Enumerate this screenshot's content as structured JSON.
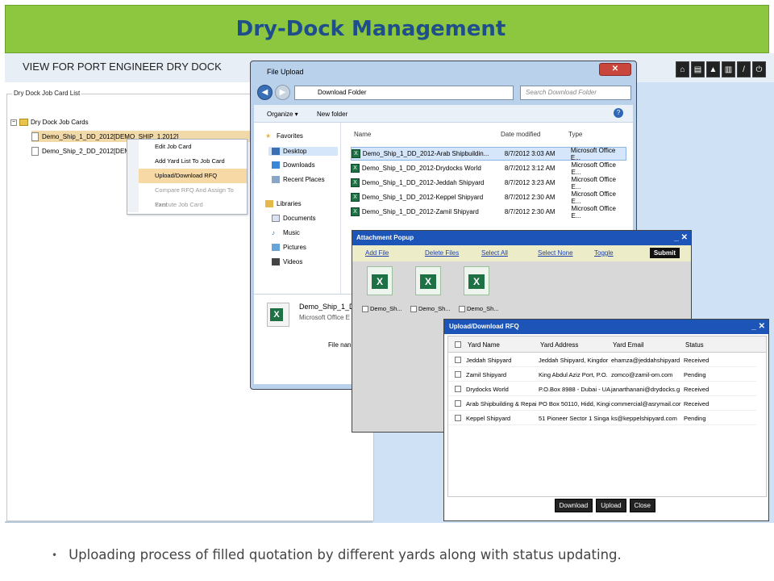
{
  "banner": {
    "title": "Dry-Dock Management"
  },
  "app": {
    "title": "VIEW FOR PORT ENGINEER DRY DOCK",
    "toolbar": [
      {
        "icon": "home-icon",
        "glyph": "⌂"
      },
      {
        "icon": "print-icon",
        "glyph": "▤"
      },
      {
        "icon": "warning-icon",
        "glyph": "▲"
      },
      {
        "icon": "document-icon",
        "glyph": "▥"
      },
      {
        "icon": "edit-icon",
        "glyph": "/"
      },
      {
        "icon": "power-icon",
        "glyph": "⏻"
      }
    ]
  },
  "job_card_list": {
    "legend": "Dry Dock Job Card List",
    "root": "Dry Dock Job Cards",
    "items": [
      "Demo_Ship_1_DD_2012[DEMO_SHIP_1.2012]",
      "Demo_Ship_2_DD_2012[DEMO_"
    ]
  },
  "context_menu": {
    "items": [
      {
        "label": "Edit Job Card",
        "state": "normal"
      },
      {
        "label": "Add Yard List To Job Card",
        "state": "normal"
      },
      {
        "label": "Upload/Download RFQ",
        "state": "highlighted"
      },
      {
        "label": "Compare RFQ And Assign To Yard",
        "state": "disabled"
      },
      {
        "label": "Execute Job Card",
        "state": "disabled"
      }
    ]
  },
  "file_upload": {
    "title": "File Upload",
    "close": "✕",
    "address": "Download Folder",
    "search_placeholder": "Search Download Folder",
    "organize": "Organize ▾",
    "new_folder": "New folder",
    "nav": {
      "favorites": "Favorites",
      "desktop": "Desktop",
      "downloads": "Downloads",
      "recent": "Recent Places",
      "libraries": "Libraries",
      "documents": "Documents",
      "music": "Music",
      "pictures": "Pictures",
      "videos": "Videos"
    },
    "columns": {
      "name": "Name",
      "date": "Date modified",
      "type": "Type"
    },
    "files": [
      {
        "name": "Demo_Ship_1_DD_2012-Arab Shipbuildin...",
        "date": "8/7/2012 3:03 AM",
        "type": "Microsoft Office E..."
      },
      {
        "name": "Demo_Ship_1_DD_2012-Drydocks World",
        "date": "8/7/2012 3:12 AM",
        "type": "Microsoft Office E..."
      },
      {
        "name": "Demo_Ship_1_DD_2012-Jeddah Shipyard",
        "date": "8/7/2012 3:23 AM",
        "type": "Microsoft Office E..."
      },
      {
        "name": "Demo_Ship_1_DD_2012-Keppel Shipyard",
        "date": "8/7/2012 2:30 AM",
        "type": "Microsoft Office E..."
      },
      {
        "name": "Demo_Ship_1_DD_2012-Zamil Shipyard",
        "date": "8/7/2012 2:30 AM",
        "type": "Microsoft Office E..."
      }
    ],
    "preview_name": "Demo_Ship_1_DD",
    "preview_type": "Microsoft Office E",
    "file_name_label": "File nan"
  },
  "attachment_popup": {
    "title": "Attachment Popup",
    "controls": "_ ✕",
    "links": [
      "Add File",
      "Delete Files",
      "Select All",
      "Select None",
      "Toggle"
    ],
    "submit": "Submit",
    "thumbs": [
      "Demo_Sh...",
      "Demo_Sh...",
      "Demo_Sh..."
    ]
  },
  "rfq": {
    "title": "Upload/Download RFQ",
    "controls": "_ ✕",
    "columns": [
      "Yard Name",
      "Yard Address",
      "Yard Email",
      "Status"
    ],
    "rows": [
      {
        "name": "Jeddah Shipyard",
        "address": "Jeddah Shipyard, Kingdor",
        "email": "ehamza@jeddahshipyard",
        "status": "Received"
      },
      {
        "name": "Zamil Shipyard",
        "address": "King Abdul Aziz Port, P.O.",
        "email": "zomco@zamil-om.com",
        "status": "Pending"
      },
      {
        "name": "Drydocks World",
        "address": "P.O.Box 8988 - Dubai - UA",
        "email": "janarthanani@drydocks.g",
        "status": "Received"
      },
      {
        "name": "Arab Shipbuilding & Repai",
        "address": "PO Box 50110, Hidd, Kingi",
        "email": "commercial@asrymail.cor",
        "status": "Received"
      },
      {
        "name": "Keppel Shipyard",
        "address": "51 Pioneer Sector 1 Singa",
        "email": "ks@keppelshipyard.com",
        "status": "Pending"
      }
    ],
    "buttons": [
      "Download",
      "Upload",
      "Close"
    ]
  },
  "caption": {
    "bullet": "•",
    "text": "Uploading process of filled quotation by different yards along with status updating."
  }
}
